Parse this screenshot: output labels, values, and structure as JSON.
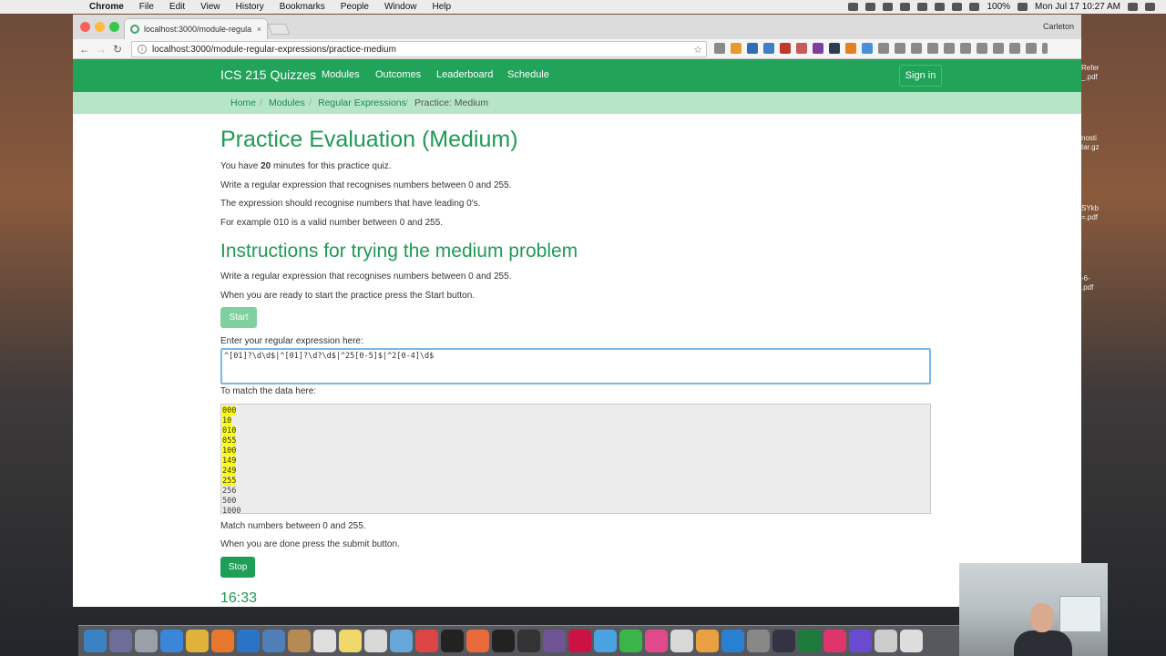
{
  "menubar": {
    "app": "Chrome",
    "items": [
      "File",
      "Edit",
      "View",
      "History",
      "Bookmarks",
      "People",
      "Window",
      "Help"
    ],
    "battery": "100%",
    "clock": "Mon Jul 17  10:27 AM"
  },
  "browser": {
    "tab_title": "localhost:3000/module-regula",
    "tab_close": "×",
    "profile": "Carleton",
    "url_host": "localhost",
    "url": "localhost:3000/module-regular-expressions/practice-medium"
  },
  "site": {
    "brand": "ICS 215 Quizzes",
    "nav": [
      "Modules",
      "Outcomes",
      "Leaderboard",
      "Schedule"
    ],
    "signin": "Sign in",
    "breadcrumb": [
      "Home",
      "Modules",
      "Regular Expressions",
      "Practice: Medium"
    ],
    "breadcrumb_sep": "/"
  },
  "page": {
    "title": "Practice Evaluation (Medium)",
    "time_prefix": "You have ",
    "time_minutes": "20",
    "time_suffix": " minutes for this practice quiz.",
    "desc1": "Write a regular expression that recognises numbers between 0 and 255.",
    "desc2": "The expression should recognise numbers that have leading 0's.",
    "desc3": "For example 010 is a valid number between 0 and 255.",
    "instructions_title": "Instructions for trying the medium problem",
    "instr1": "Write a regular expression that recognises numbers between 0 and 255.",
    "instr2": "When you are ready to start the practice press the Start button.",
    "start_label": "Start",
    "regex_label": "Enter your regular expression here:",
    "regex_value": "^[01]?\\d\\d$|^[01]?\\d?\\d$|^25[0-5]$|^2[0-4]\\d$",
    "data_label": "To match the data here:",
    "data_lines": [
      {
        "text": "000",
        "match": true
      },
      {
        "text": "10",
        "match": true
      },
      {
        "text": "010",
        "match": true
      },
      {
        "text": "055",
        "match": true
      },
      {
        "text": "100",
        "match": true
      },
      {
        "text": "149",
        "match": true
      },
      {
        "text": "249",
        "match": true
      },
      {
        "text": "255",
        "match": true
      },
      {
        "text": "256",
        "match": false
      },
      {
        "text": "500",
        "match": false
      },
      {
        "text": "1000",
        "match": false
      }
    ],
    "match_note": "Match numbers between 0 and 255.",
    "submit_note": "When you are done press the submit button.",
    "stop_label": "Stop",
    "timer": "16:33"
  },
  "desktop_files": [
    "Refer\n_.pdf",
    "nosti\ntar.gz",
    "SYkb\n=.pdf",
    "-6-\n.pdf"
  ],
  "colors": {
    "brand_green": "#21a35a",
    "breadcrumb_bg": "#b6e6c7",
    "heading_green": "#1f9a55",
    "highlight": "#ffff00"
  }
}
